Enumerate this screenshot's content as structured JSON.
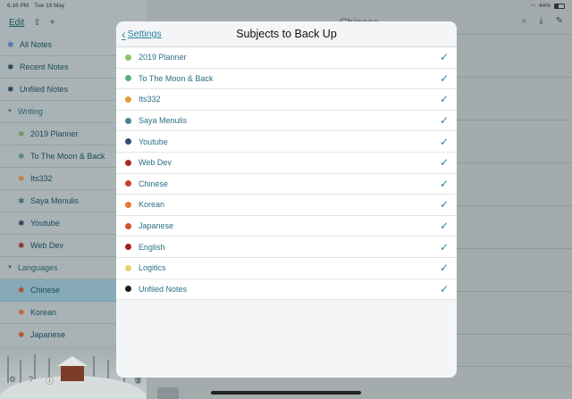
{
  "status": {
    "time": "6:16 PM",
    "date": "Tue 19 May",
    "battery": "44%"
  },
  "sidebar": {
    "edit_label": "Edit",
    "items": [
      {
        "label": "All Notes",
        "star_color": "#4a6fb0",
        "type": "top"
      },
      {
        "label": "Recent Notes",
        "star_color": "#1f3f55",
        "type": "top"
      },
      {
        "label": "Unfiled Notes",
        "star_color": "#1f3f55",
        "type": "top"
      },
      {
        "label": "Writing",
        "type": "section"
      },
      {
        "label": "2019 Planner",
        "star_color": "#6e9a5c",
        "type": "sub"
      },
      {
        "label": "To The Moon & Back",
        "star_color": "#4e8a6a",
        "type": "sub"
      },
      {
        "label": "Its332",
        "star_color": "#c07a3a",
        "type": "sub"
      },
      {
        "label": "Saya Menulis",
        "star_color": "#3b6d78",
        "type": "sub"
      },
      {
        "label": "Youtube",
        "star_color": "#2a3f5f",
        "type": "sub"
      },
      {
        "label": "Web Dev",
        "star_color": "#8a2a2a",
        "type": "sub"
      },
      {
        "label": "Languages",
        "type": "section"
      },
      {
        "label": "Chinese",
        "star_color": "#b04a2a",
        "type": "sub",
        "selected": true
      },
      {
        "label": "Korean",
        "star_color": "#c0642e",
        "type": "sub"
      },
      {
        "label": "Japanese",
        "star_color": "#b0482a",
        "type": "sub"
      }
    ]
  },
  "main": {
    "title": "Chinese"
  },
  "modal": {
    "back_label": "Settings",
    "title": "Subjects to Back Up",
    "subjects": [
      {
        "name": "2019 Planner",
        "color": "#8bc26a",
        "checked": true
      },
      {
        "name": "To The Moon & Back",
        "color": "#55b080",
        "checked": true
      },
      {
        "name": "Its332",
        "color": "#e79a3c",
        "checked": true
      },
      {
        "name": "Saya Menulis",
        "color": "#4a8391",
        "checked": true
      },
      {
        "name": "Youtube",
        "color": "#2e4d74",
        "checked": true
      },
      {
        "name": "Web Dev",
        "color": "#a42a24",
        "checked": true
      },
      {
        "name": "Chinese",
        "color": "#c8402a",
        "checked": true
      },
      {
        "name": "Korean",
        "color": "#e8773a",
        "checked": true
      },
      {
        "name": "Japanese",
        "color": "#d3522f",
        "checked": true
      },
      {
        "name": "English",
        "color": "#a4201c",
        "checked": true
      },
      {
        "name": "Logitics",
        "color": "#edcf6a",
        "checked": true
      },
      {
        "name": "Unfiled Notes",
        "color": "#1a1a1a",
        "checked": true
      }
    ]
  }
}
